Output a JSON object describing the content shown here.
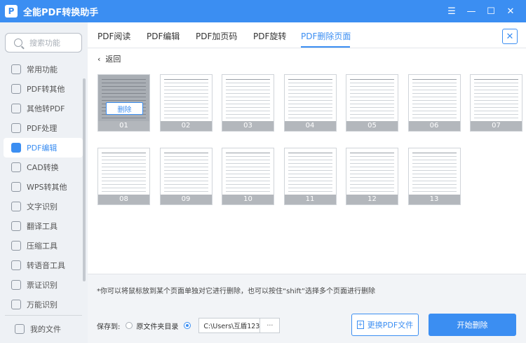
{
  "titlebar": {
    "title": "全能PDF转换助手",
    "logo": "P"
  },
  "search": {
    "placeholder": "搜索功能"
  },
  "sidebar": {
    "items": [
      {
        "label": "常用功能",
        "icon": "star-icon"
      },
      {
        "label": "PDF转其他",
        "icon": "pdf-out-icon"
      },
      {
        "label": "其他转PDF",
        "icon": "pdf-in-icon"
      },
      {
        "label": "PDF处理",
        "icon": "pdf-process-icon"
      },
      {
        "label": "PDF编辑",
        "icon": "pdf-edit-icon"
      },
      {
        "label": "CAD转换",
        "icon": "cad-icon"
      },
      {
        "label": "WPS转其他",
        "icon": "wps-icon"
      },
      {
        "label": "文字识别",
        "icon": "ocr-icon"
      },
      {
        "label": "翻译工具",
        "icon": "translate-icon"
      },
      {
        "label": "压缩工具",
        "icon": "compress-icon"
      },
      {
        "label": "转语音工具",
        "icon": "voice-icon"
      },
      {
        "label": "票证识别",
        "icon": "ticket-icon"
      },
      {
        "label": "万能识别",
        "icon": "scan-icon"
      }
    ],
    "my_files": "我的文件"
  },
  "tabs": [
    {
      "label": "PDF阅读"
    },
    {
      "label": "PDF编辑"
    },
    {
      "label": "PDF加页码"
    },
    {
      "label": "PDF旋转"
    },
    {
      "label": "PDF删除页面"
    }
  ],
  "back_label": "返回",
  "pages": [
    "01",
    "02",
    "03",
    "04",
    "05",
    "06",
    "07",
    "08",
    "09",
    "10",
    "11",
    "12",
    "13"
  ],
  "delete_label": "删除",
  "hint": "*你可以将鼠标放到某个页面单独对它进行删除，也可以按住“shift”选择多个页面进行删除",
  "save": {
    "label": "保存到:",
    "option_source": "原文件夹目录",
    "path": "C:\\Users\\互盾123...",
    "more": "···"
  },
  "replace_label": "更换PDF文件",
  "start_label": "开始删除",
  "colors": {
    "accent": "#3b8ef2"
  }
}
